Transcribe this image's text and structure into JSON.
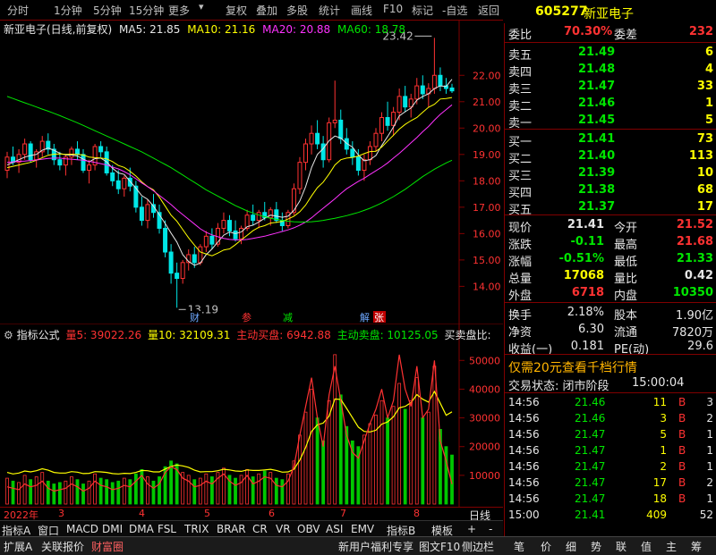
{
  "toolbar": {
    "left": [
      "分时",
      "1分钟",
      "5分钟",
      "15分钟",
      "更多"
    ],
    "right": [
      "复权",
      "叠加",
      "多股",
      "统计",
      "画线",
      "F10",
      "标记",
      "-自选",
      "返回"
    ]
  },
  "stock": {
    "code": "605277",
    "name": "新亚电子"
  },
  "chart_header": {
    "title": "新亚电子(日线,前复权)",
    "ma5": "MA5: 21.85",
    "ma10": "MA10: 21.16",
    "ma20": "MA20: 20.88",
    "ma60": "MA60: 18.78",
    "high_label": "23.42",
    "low_label": "13.19"
  },
  "markers": [
    "财",
    "参",
    "减",
    "解",
    "张"
  ],
  "indicator_header": {
    "name": "指标公式",
    "v5": "量5: 39022.26",
    "v10": "量10: 32109.31",
    "buy": "主动买盘: 6942.88",
    "sell": "主动卖盘: 10125.05",
    "net": "买卖盘比:"
  },
  "date_axis": {
    "labels": [
      "2022年",
      "3",
      "4",
      "5",
      "6",
      "7",
      "8"
    ],
    "right": "日线"
  },
  "tabs": [
    "指标A",
    "窗口",
    "MACD",
    "DMI",
    "DMA",
    "FSL",
    "TRIX",
    "BRAR",
    "CR",
    "VR",
    "OBV",
    "ASI",
    "EMV",
    "指标B",
    "模板",
    "+",
    "-"
  ],
  "bottom_bar": {
    "left": [
      "扩展A",
      "关联报价",
      "财富圈"
    ],
    "mid": [
      "新用户福利专享",
      "图文F10",
      "侧边栏"
    ],
    "right": [
      "笔",
      "价",
      "细",
      "势",
      "联",
      "值",
      "主",
      "筹"
    ]
  },
  "panel": {
    "weibi": {
      "label": "委比",
      "value": "70.30%",
      "label2": "委差",
      "value2": "232"
    },
    "sells": [
      {
        "label": "卖五",
        "price": "21.49",
        "vol": "6"
      },
      {
        "label": "卖四",
        "price": "21.48",
        "vol": "4"
      },
      {
        "label": "卖三",
        "price": "21.47",
        "vol": "33"
      },
      {
        "label": "卖二",
        "price": "21.46",
        "vol": "1"
      },
      {
        "label": "卖一",
        "price": "21.45",
        "vol": "5"
      }
    ],
    "buys": [
      {
        "label": "买一",
        "price": "21.41",
        "vol": "73"
      },
      {
        "label": "买二",
        "price": "21.40",
        "vol": "113"
      },
      {
        "label": "买三",
        "price": "21.39",
        "vol": "10"
      },
      {
        "label": "买四",
        "price": "21.38",
        "vol": "68"
      },
      {
        "label": "买五",
        "price": "21.37",
        "vol": "17"
      }
    ],
    "quote": [
      {
        "l1": "现价",
        "v1": "21.41",
        "l2": "今开",
        "v2": "21.52"
      },
      {
        "l1": "涨跌",
        "v1": "-0.11",
        "l2": "最高",
        "v2": "21.68"
      },
      {
        "l1": "涨幅",
        "v1": "-0.51%",
        "l2": "最低",
        "v2": "21.33"
      },
      {
        "l1": "总量",
        "v1": "17068",
        "l2": "量比",
        "v2": "0.42"
      },
      {
        "l1": "外盘",
        "v1": "6718",
        "l2": "内盘",
        "v2": "10350"
      }
    ],
    "info": [
      {
        "l1": "换手",
        "v1": "2.18%",
        "l2": "股本",
        "v2": "1.90亿"
      },
      {
        "l1": "净资",
        "v1": "6.30",
        "l2": "流通",
        "v2": "7820万"
      },
      {
        "l1": "收益(一)",
        "v1": "0.181",
        "l2": "PE(动)",
        "v2": "29.6"
      }
    ],
    "promo": "仅需20元查看千档行情",
    "status_label": "交易状态: 闭市阶段",
    "status_time": "15:00:04",
    "ticks": [
      {
        "t": "14:56",
        "p": "21.46",
        "v": "11",
        "s": "B",
        "n": "3"
      },
      {
        "t": "14:56",
        "p": "21.46",
        "v": "3",
        "s": "B",
        "n": "2"
      },
      {
        "t": "14:56",
        "p": "21.47",
        "v": "5",
        "s": "B",
        "n": "1"
      },
      {
        "t": "14:56",
        "p": "21.47",
        "v": "1",
        "s": "B",
        "n": "1"
      },
      {
        "t": "14:56",
        "p": "21.47",
        "v": "2",
        "s": "B",
        "n": "1"
      },
      {
        "t": "14:56",
        "p": "21.47",
        "v": "17",
        "s": "B",
        "n": "2"
      },
      {
        "t": "14:56",
        "p": "21.47",
        "v": "18",
        "s": "B",
        "n": "1"
      },
      {
        "t": "15:00",
        "p": "21.41",
        "v": "409",
        "s": "",
        "n": "52"
      }
    ]
  },
  "chart_data": {
    "type": "candlestick",
    "price_axis": {
      "ticks": [
        "22.00",
        "21.00",
        "20.00",
        "19.00",
        "18.00",
        "17.00",
        "16.00",
        "15.00",
        "14.00"
      ],
      "range": [
        13.2,
        23.5
      ]
    },
    "volume_axis": {
      "ticks": [
        "50000",
        "40000",
        "30000",
        "20000",
        "10000"
      ],
      "range": [
        0,
        56000
      ]
    },
    "ohlc": [
      [
        18.4,
        19.1,
        18.1,
        18.9
      ],
      [
        18.9,
        19.3,
        18.6,
        18.7
      ],
      [
        18.7,
        19.2,
        18.3,
        19.0
      ],
      [
        19.0,
        19.6,
        18.8,
        19.4
      ],
      [
        19.4,
        19.5,
        18.7,
        18.8
      ],
      [
        18.8,
        19.2,
        18.5,
        19.1
      ],
      [
        19.1,
        19.7,
        18.9,
        19.5
      ],
      [
        19.5,
        19.8,
        19.0,
        19.2
      ],
      [
        19.2,
        19.4,
        18.6,
        18.8
      ],
      [
        18.8,
        19.1,
        18.4,
        18.6
      ],
      [
        18.6,
        19.0,
        18.2,
        18.9
      ],
      [
        18.9,
        19.3,
        18.6,
        19.2
      ],
      [
        19.2,
        19.5,
        18.8,
        19.0
      ],
      [
        19.0,
        19.2,
        18.3,
        18.4
      ],
      [
        18.4,
        18.8,
        17.9,
        18.6
      ],
      [
        18.6,
        19.4,
        18.4,
        19.3
      ],
      [
        19.3,
        19.5,
        18.9,
        19.1
      ],
      [
        19.1,
        19.3,
        18.2,
        18.3
      ],
      [
        18.3,
        18.6,
        17.8,
        18.0
      ],
      [
        18.0,
        18.4,
        17.5,
        17.7
      ],
      [
        17.7,
        18.2,
        17.4,
        18.1
      ],
      [
        18.1,
        18.5,
        17.6,
        17.8
      ],
      [
        17.8,
        18.0,
        16.8,
        17.0
      ],
      [
        17.0,
        17.4,
        16.3,
        16.5
      ],
      [
        16.5,
        17.3,
        16.2,
        17.1
      ],
      [
        17.1,
        17.5,
        16.6,
        16.8
      ],
      [
        16.8,
        17.1,
        16.0,
        16.2
      ],
      [
        16.2,
        16.5,
        15.1,
        15.3
      ],
      [
        15.3,
        15.6,
        14.1,
        14.5
      ],
      [
        14.5,
        14.9,
        13.19,
        14.3
      ],
      [
        14.3,
        15.0,
        14.1,
        14.9
      ],
      [
        14.9,
        15.4,
        14.6,
        15.2
      ],
      [
        15.2,
        15.5,
        14.7,
        14.9
      ],
      [
        14.9,
        15.6,
        14.8,
        15.5
      ],
      [
        15.5,
        16.1,
        15.3,
        15.9
      ],
      [
        15.9,
        16.2,
        15.4,
        15.6
      ],
      [
        15.6,
        16.4,
        15.5,
        16.2
      ],
      [
        16.2,
        16.8,
        16.0,
        16.5
      ],
      [
        16.5,
        16.7,
        15.9,
        16.1
      ],
      [
        16.1,
        16.5,
        15.7,
        15.8
      ],
      [
        15.8,
        16.3,
        15.6,
        16.2
      ],
      [
        16.2,
        16.9,
        16.1,
        16.7
      ],
      [
        16.7,
        17.1,
        16.3,
        16.5
      ],
      [
        16.5,
        16.9,
        16.2,
        16.8
      ],
      [
        16.8,
        17.2,
        16.5,
        16.6
      ],
      [
        16.6,
        17.0,
        16.3,
        16.9
      ],
      [
        16.9,
        17.2,
        16.4,
        16.5
      ],
      [
        16.5,
        16.8,
        16.1,
        16.3
      ],
      [
        16.3,
        16.9,
        16.2,
        16.8
      ],
      [
        16.8,
        17.9,
        16.7,
        17.7
      ],
      [
        17.7,
        18.9,
        17.5,
        18.7
      ],
      [
        18.7,
        19.6,
        18.4,
        19.4
      ],
      [
        19.4,
        20.1,
        19.0,
        19.8
      ],
      [
        19.8,
        20.3,
        19.2,
        19.4
      ],
      [
        19.4,
        19.7,
        18.5,
        18.8
      ],
      [
        18.8,
        20.4,
        18.7,
        20.2
      ],
      [
        20.2,
        21.8,
        20.0,
        20.3
      ],
      [
        20.3,
        20.7,
        19.4,
        19.6
      ],
      [
        19.6,
        20.0,
        19.0,
        19.2
      ],
      [
        19.2,
        19.5,
        18.6,
        18.9
      ],
      [
        18.9,
        19.2,
        18.2,
        18.4
      ],
      [
        18.4,
        19.0,
        18.0,
        18.8
      ],
      [
        18.8,
        19.5,
        18.6,
        19.3
      ],
      [
        19.3,
        20.0,
        19.1,
        19.8
      ],
      [
        19.8,
        20.6,
        19.5,
        20.4
      ],
      [
        20.4,
        21.0,
        19.9,
        20.1
      ],
      [
        20.1,
        20.8,
        19.7,
        20.6
      ],
      [
        20.6,
        21.5,
        20.3,
        21.2
      ],
      [
        21.2,
        21.6,
        20.6,
        20.8
      ],
      [
        20.8,
        21.3,
        20.4,
        21.1
      ],
      [
        21.1,
        21.9,
        20.9,
        21.6
      ],
      [
        21.6,
        22.0,
        21.1,
        21.3
      ],
      [
        21.3,
        21.7,
        20.8,
        21.5
      ],
      [
        21.5,
        23.42,
        21.3,
        22.0
      ],
      [
        22.0,
        22.3,
        21.4,
        21.6
      ],
      [
        21.6,
        21.9,
        21.3,
        21.5
      ],
      [
        21.52,
        21.68,
        21.33,
        21.41
      ]
    ],
    "ma5": [
      18.6,
      18.7,
      18.8,
      18.9,
      18.96,
      19.0,
      19.16,
      19.24,
      19.16,
      19.04,
      18.98,
      18.98,
      18.94,
      18.82,
      18.72,
      18.84,
      18.86,
      18.72,
      18.48,
      18.3,
      18.24,
      17.98,
      17.72,
      17.44,
      17.3,
      17.04,
      16.72,
      16.38,
      16.02,
      15.68,
      15.2,
      14.94,
      14.8,
      14.88,
      15.2,
      15.42,
      15.68,
      15.94,
      16.06,
      16.0,
      16.06,
      16.26,
      16.32,
      16.44,
      16.58,
      16.7,
      16.66,
      16.62,
      16.66,
      16.88,
      17.24,
      17.78,
      18.5,
      19.0,
      19.22,
      19.52,
      19.7,
      19.62,
      19.42,
      19.28,
      18.98,
      18.76,
      18.8,
      18.96,
      19.34,
      19.68,
      20.04,
      20.46,
      20.62,
      20.76,
      21.06,
      21.2,
      21.3,
      21.5,
      21.6,
      21.58,
      21.85
    ],
    "ma10": [
      18.5,
      18.55,
      18.6,
      18.65,
      18.7,
      18.78,
      18.88,
      18.97,
      19.01,
      19.02,
      19.0,
      19.01,
      19.0,
      18.98,
      18.9,
      18.88,
      18.87,
      18.83,
      18.73,
      18.58,
      18.51,
      18.36,
      18.18,
      17.96,
      17.78,
      17.66,
      17.38,
      17.04,
      16.7,
      16.47,
      16.15,
      15.84,
      15.56,
      15.3,
      15.23,
      15.16,
      15.26,
      15.38,
      15.42,
      15.58,
      15.76,
      15.93,
      16.11,
      16.24,
      16.3,
      16.4,
      16.43,
      16.46,
      16.55,
      16.66,
      16.83,
      17.08,
      17.43,
      17.74,
      17.95,
      18.26,
      18.6,
      18.8,
      18.86,
      18.89,
      18.94,
      19.03,
      19.11,
      19.12,
      19.28,
      19.51,
      19.73,
      19.96,
      20.14,
      20.28,
      20.4,
      20.6,
      20.79,
      20.9,
      21.1,
      21.12,
      21.16
    ],
    "ma20": [
      18.7,
      18.72,
      18.74,
      18.75,
      18.77,
      18.79,
      18.82,
      18.85,
      18.86,
      18.86,
      18.83,
      18.82,
      18.8,
      18.78,
      18.74,
      18.7,
      18.65,
      18.6,
      18.52,
      18.45,
      18.35,
      18.23,
      18.08,
      17.92,
      17.78,
      17.62,
      17.45,
      17.28,
      17.1,
      16.9,
      16.72,
      16.54,
      16.36,
      16.18,
      16.05,
      15.95,
      15.88,
      15.82,
      15.78,
      15.76,
      15.76,
      15.78,
      15.82,
      15.86,
      15.9,
      15.96,
      16.02,
      16.08,
      16.14,
      16.22,
      16.32,
      16.44,
      16.6,
      16.78,
      16.96,
      17.14,
      17.32,
      17.52,
      17.7,
      17.84,
      17.98,
      18.1,
      18.24,
      18.38,
      18.52,
      18.68,
      18.86,
      19.04,
      19.24,
      19.44,
      19.64,
      19.86,
      20.06,
      20.3,
      20.52,
      20.7,
      20.88
    ],
    "ma60": [
      21.2,
      21.12,
      21.04,
      20.96,
      20.88,
      20.8,
      20.72,
      20.64,
      20.56,
      20.47,
      20.38,
      20.29,
      20.2,
      20.1,
      20.0,
      19.9,
      19.8,
      19.7,
      19.6,
      19.5,
      19.4,
      19.3,
      19.2,
      19.1,
      18.98,
      18.86,
      18.74,
      18.62,
      18.5,
      18.36,
      18.22,
      18.08,
      17.94,
      17.8,
      17.66,
      17.54,
      17.42,
      17.3,
      17.18,
      17.06,
      16.96,
      16.86,
      16.78,
      16.7,
      16.64,
      16.58,
      16.54,
      16.5,
      16.47,
      16.45,
      16.44,
      16.44,
      16.45,
      16.47,
      16.5,
      16.54,
      16.58,
      16.63,
      16.68,
      16.74,
      16.8,
      16.88,
      16.96,
      17.06,
      17.16,
      17.28,
      17.4,
      17.54,
      17.68,
      17.84,
      18.0,
      18.16,
      18.3,
      18.44,
      18.56,
      18.68,
      18.78
    ],
    "volume": [
      9000,
      8000,
      7500,
      10000,
      8500,
      9500,
      11000,
      8000,
      7000,
      7500,
      8000,
      9500,
      8500,
      7000,
      8000,
      10500,
      9000,
      8500,
      7500,
      8000,
      9000,
      8500,
      10500,
      12000,
      9500,
      8000,
      9500,
      13000,
      15000,
      14000,
      11000,
      10000,
      8500,
      9000,
      10500,
      9500,
      11000,
      12500,
      10000,
      9000,
      10000,
      12000,
      9500,
      10500,
      11500,
      11000,
      9000,
      8500,
      10500,
      15000,
      24000,
      32000,
      40000,
      30000,
      22000,
      36000,
      52000,
      38000,
      27000,
      22000,
      20000,
      24000,
      28000,
      31000,
      36000,
      30000,
      34000,
      42000,
      33000,
      36000,
      44000,
      30000,
      32000,
      48000,
      26000,
      20000,
      17068
    ],
    "buy_line": [
      11000,
      10500,
      10800,
      11500,
      11200,
      11600,
      12300,
      11800,
      11000,
      10800,
      10800,
      11300,
      11100,
      10600,
      10700,
      11300,
      11200,
      11000,
      10600,
      10500,
      10700,
      10600,
      11000,
      11700,
      11600,
      11200,
      11200,
      12200,
      13100,
      13600,
      13300,
      12800,
      11800,
      11200,
      11300,
      11300,
      11600,
      12100,
      11900,
      11500,
      11400,
      11900,
      11700,
      11700,
      11900,
      12100,
      11700,
      11100,
      11200,
      12100,
      15300,
      19700,
      25300,
      27600,
      28200,
      30600,
      36600,
      36400,
      33300,
      30100,
      26800,
      25300,
      25100,
      25700,
      27800,
      28600,
      30400,
      33500,
      34000,
      35300,
      38100,
      36500,
      35500,
      39200,
      35100,
      30900,
      32109
    ],
    "red_line": [
      6000,
      5500,
      5000,
      7000,
      6000,
      6500,
      8000,
      5500,
      4500,
      5000,
      5500,
      7000,
      6000,
      4500,
      5500,
      8000,
      6500,
      6000,
      5000,
      5500,
      6500,
      6000,
      8000,
      10000,
      7000,
      5500,
      7000,
      11000,
      13000,
      12000,
      9000,
      8000,
      6000,
      6500,
      8000,
      7000,
      9000,
      10500,
      8000,
      6500,
      7500,
      10000,
      7000,
      8000,
      9500,
      9000,
      6500,
      6000,
      8000,
      13000,
      24000,
      34000,
      44000,
      30000,
      20000,
      38000,
      48000,
      36000,
      24000,
      18000,
      16000,
      22000,
      28000,
      33000,
      40000,
      30000,
      36000,
      52000,
      40000,
      34000,
      48000,
      30000,
      33000,
      50000,
      22000,
      15000,
      6942
    ]
  }
}
